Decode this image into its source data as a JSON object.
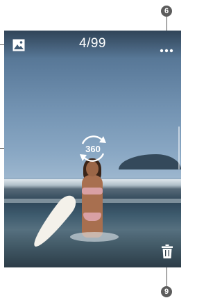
{
  "header": {
    "counter": "4/99",
    "gallery_icon": "gallery-icon",
    "more_icon": "more-options-icon"
  },
  "center": {
    "rotate_label": "360",
    "rotate_icon": "360-rotate-icon"
  },
  "footer": {
    "delete_icon": "trash-icon"
  },
  "callouts": {
    "top_right": "6",
    "bottom_right": "9"
  },
  "colors": {
    "overlay_icon": "#ffffff",
    "callout_badge": "#5c5c5c"
  }
}
